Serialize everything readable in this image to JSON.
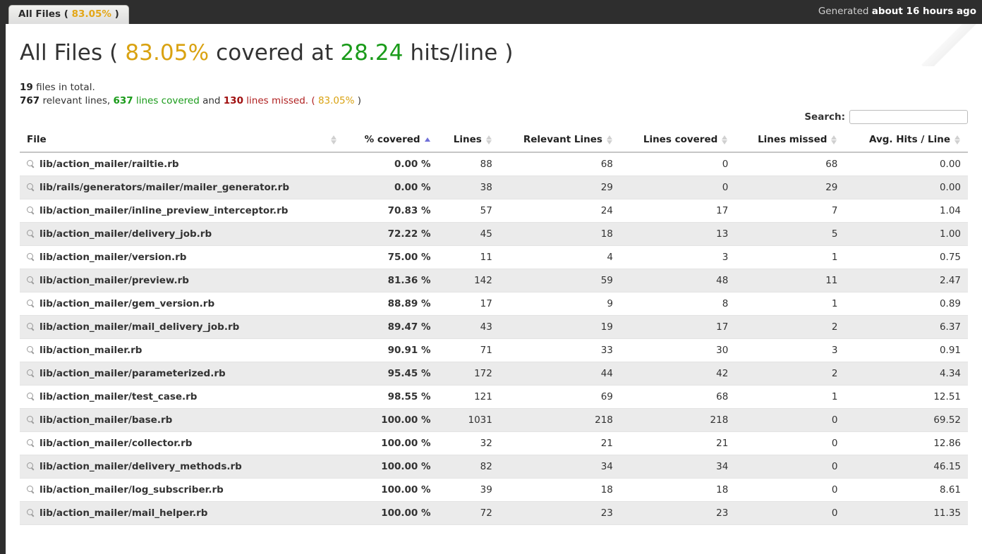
{
  "topbar": {
    "generated_prefix": "Generated",
    "generated_value": "about 16 hours ago"
  },
  "tab": {
    "label": "All Files (",
    "percent": "83.05%",
    "label_end": ")"
  },
  "header": {
    "title_prefix": "All Files (",
    "coverage_percent": "83.05%",
    "title_mid": "covered at",
    "hits_per_line": "28.24",
    "title_suffix": "hits/line )"
  },
  "summary": {
    "file_count": "19",
    "file_count_text": "files in total.",
    "relevant_lines": "767",
    "relevant_lines_text": "relevant lines,",
    "lines_covered": "637",
    "lines_covered_text": "lines covered",
    "and_text": "and",
    "lines_missed": "130",
    "lines_missed_text": "lines missed. (",
    "summary_percent": "83.05%",
    "summary_percent_end": ")"
  },
  "search": {
    "label": "Search:",
    "value": "",
    "placeholder": ""
  },
  "colors": {
    "low": "#a30f0f",
    "medium": "#d9a211",
    "high": "#169916",
    "sort_active": "#6f6fd8",
    "topbar_bg": "#2e2e2e"
  },
  "table": {
    "columns": [
      {
        "label": "File",
        "sort": "none",
        "align": "left"
      },
      {
        "label": "% covered",
        "sort": "asc",
        "align": "right"
      },
      {
        "label": "Lines",
        "sort": "none",
        "align": "right"
      },
      {
        "label": "Relevant Lines",
        "sort": "none",
        "align": "right"
      },
      {
        "label": "Lines covered",
        "sort": "none",
        "align": "right"
      },
      {
        "label": "Lines missed",
        "sort": "none",
        "align": "right"
      },
      {
        "label": "Avg. Hits / Line",
        "sort": "none",
        "align": "right"
      }
    ],
    "rows": [
      {
        "file": "lib/action_mailer/railtie.rb",
        "covered": "0.00 %",
        "level": "low",
        "lines": "88",
        "relevant": "68",
        "covered_lines": "0",
        "missed": "68",
        "avg_hits": "0.00"
      },
      {
        "file": "lib/rails/generators/mailer/mailer_generator.rb",
        "covered": "0.00 %",
        "level": "low",
        "lines": "38",
        "relevant": "29",
        "covered_lines": "0",
        "missed": "29",
        "avg_hits": "0.00"
      },
      {
        "file": "lib/action_mailer/inline_preview_interceptor.rb",
        "covered": "70.83 %",
        "level": "low",
        "lines": "57",
        "relevant": "24",
        "covered_lines": "17",
        "missed": "7",
        "avg_hits": "1.04"
      },
      {
        "file": "lib/action_mailer/delivery_job.rb",
        "covered": "72.22 %",
        "level": "low",
        "lines": "45",
        "relevant": "18",
        "covered_lines": "13",
        "missed": "5",
        "avg_hits": "1.00"
      },
      {
        "file": "lib/action_mailer/version.rb",
        "covered": "75.00 %",
        "level": "low",
        "lines": "11",
        "relevant": "4",
        "covered_lines": "3",
        "missed": "1",
        "avg_hits": "0.75"
      },
      {
        "file": "lib/action_mailer/preview.rb",
        "covered": "81.36 %",
        "level": "medium",
        "lines": "142",
        "relevant": "59",
        "covered_lines": "48",
        "missed": "11",
        "avg_hits": "2.47"
      },
      {
        "file": "lib/action_mailer/gem_version.rb",
        "covered": "88.89 %",
        "level": "medium",
        "lines": "17",
        "relevant": "9",
        "covered_lines": "8",
        "missed": "1",
        "avg_hits": "0.89"
      },
      {
        "file": "lib/action_mailer/mail_delivery_job.rb",
        "covered": "89.47 %",
        "level": "medium",
        "lines": "43",
        "relevant": "19",
        "covered_lines": "17",
        "missed": "2",
        "avg_hits": "6.37"
      },
      {
        "file": "lib/action_mailer.rb",
        "covered": "90.91 %",
        "level": "high",
        "lines": "71",
        "relevant": "33",
        "covered_lines": "30",
        "missed": "3",
        "avg_hits": "0.91"
      },
      {
        "file": "lib/action_mailer/parameterized.rb",
        "covered": "95.45 %",
        "level": "high",
        "lines": "172",
        "relevant": "44",
        "covered_lines": "42",
        "missed": "2",
        "avg_hits": "4.34"
      },
      {
        "file": "lib/action_mailer/test_case.rb",
        "covered": "98.55 %",
        "level": "high",
        "lines": "121",
        "relevant": "69",
        "covered_lines": "68",
        "missed": "1",
        "avg_hits": "12.51"
      },
      {
        "file": "lib/action_mailer/base.rb",
        "covered": "100.00 %",
        "level": "high",
        "lines": "1031",
        "relevant": "218",
        "covered_lines": "218",
        "missed": "0",
        "avg_hits": "69.52"
      },
      {
        "file": "lib/action_mailer/collector.rb",
        "covered": "100.00 %",
        "level": "high",
        "lines": "32",
        "relevant": "21",
        "covered_lines": "21",
        "missed": "0",
        "avg_hits": "12.86"
      },
      {
        "file": "lib/action_mailer/delivery_methods.rb",
        "covered": "100.00 %",
        "level": "high",
        "lines": "82",
        "relevant": "34",
        "covered_lines": "34",
        "missed": "0",
        "avg_hits": "46.15"
      },
      {
        "file": "lib/action_mailer/log_subscriber.rb",
        "covered": "100.00 %",
        "level": "high",
        "lines": "39",
        "relevant": "18",
        "covered_lines": "18",
        "missed": "0",
        "avg_hits": "8.61"
      },
      {
        "file": "lib/action_mailer/mail_helper.rb",
        "covered": "100.00 %",
        "level": "high",
        "lines": "72",
        "relevant": "23",
        "covered_lines": "23",
        "missed": "0",
        "avg_hits": "11.35"
      }
    ]
  }
}
